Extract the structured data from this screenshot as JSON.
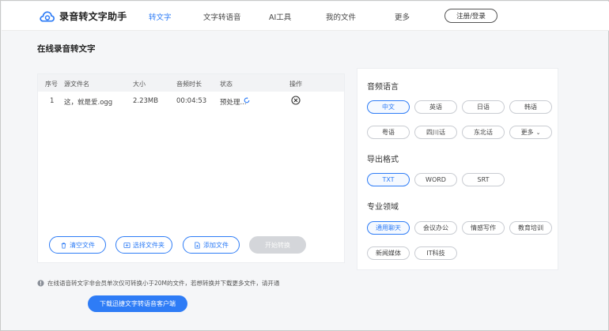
{
  "app": {
    "name": "录音转文字助手"
  },
  "nav": {
    "items": [
      {
        "label": "转文字",
        "active": true
      },
      {
        "label": "文字转语音",
        "active": false
      },
      {
        "label": "AI工具",
        "active": false
      },
      {
        "label": "我的文件",
        "active": false
      },
      {
        "label": "更多",
        "active": false
      }
    ],
    "login_label": "注册/登录"
  },
  "page": {
    "title": "在线录音转文字"
  },
  "file_table": {
    "headers": [
      "序号",
      "源文件名",
      "大小",
      "音频时长",
      "状态",
      "操作"
    ],
    "rows": [
      {
        "index": "1",
        "name": "这，就是爱.ogg",
        "size": "2.23MB",
        "duration": "00:04:53",
        "status": "预处理..."
      }
    ]
  },
  "actions": {
    "clear": "清空文件",
    "select_folder": "选择文件夹",
    "add_file": "添加文件",
    "start": "开始转换"
  },
  "settings": {
    "language": {
      "title": "音频语言",
      "options": [
        "中文",
        "英语",
        "日语",
        "韩语",
        "粤语",
        "四川话",
        "东北话",
        "更多"
      ],
      "selected": "中文"
    },
    "format": {
      "title": "导出格式",
      "options": [
        "TXT",
        "WORD",
        "SRT"
      ],
      "selected": "TXT"
    },
    "domain": {
      "title": "专业领域",
      "options": [
        "通用聊天",
        "会议办公",
        "情感写作",
        "教育培训",
        "新闻媒体",
        "IT科技"
      ],
      "selected": "通用聊天"
    }
  },
  "notice": "在线语音转文字非会员单次仅可转换小于20M的文件，若想转换并下载更多文件，请开通",
  "download_button": "下载迅捷文字转语音客户端",
  "colors": {
    "accent": "#2e7cf6",
    "disabled": "#d4d6da"
  }
}
